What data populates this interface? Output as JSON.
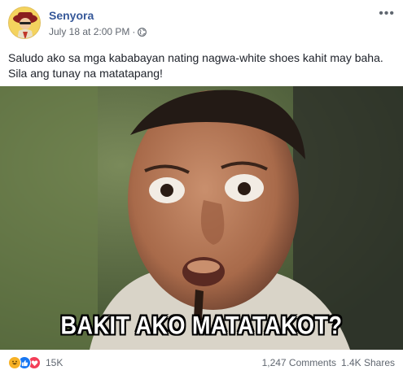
{
  "post": {
    "author": "Senyora",
    "timestamp": "July 18 at 2:00 PM",
    "separator": "·",
    "privacy_icon": "globe-icon",
    "more_label": "•••",
    "text_line1": "Saludo ako sa mga kababayan nating nagwa-white shoes kahit may baha.",
    "text_line2": "Sila ang tunay na matatapang!",
    "image_caption": "BAKIT AKO MATATAKOT?"
  },
  "footer": {
    "reactions": [
      "haha",
      "like",
      "love"
    ],
    "reaction_count": "15K",
    "comments": "1,247 Comments",
    "shares": "1.4K Shares"
  },
  "colors": {
    "author": "#365899",
    "meta": "#616770",
    "like": "#1877f2",
    "love": "#f33e58",
    "haha": "#f7b125"
  }
}
